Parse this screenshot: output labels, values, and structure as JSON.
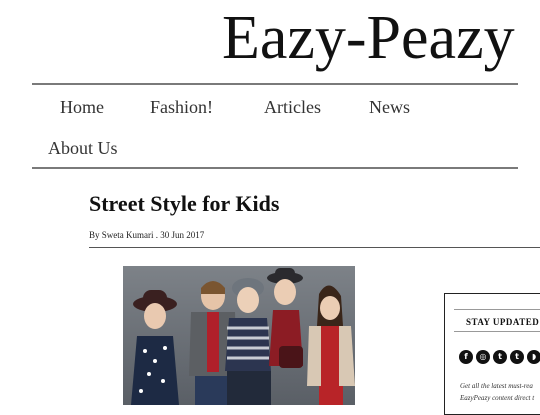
{
  "site": {
    "logo": "Eazy-Peazy"
  },
  "nav": {
    "items": [
      "Home",
      "Fashion!",
      "Articles",
      "News",
      "About Us"
    ]
  },
  "post": {
    "title": "Street Style for Kids",
    "byline": "By Sweta Kumari . 30 Jun 2017"
  },
  "sidebar": {
    "title": "STAY UPDATED",
    "social_icons": [
      "facebook-icon",
      "instagram-icon",
      "twitter-icon",
      "tumblr-icon",
      "rss-icon"
    ],
    "social_glyphs": [
      "f",
      "◎",
      "t",
      "t",
      "◗"
    ],
    "text_line1": "Get all the latest must-rea",
    "text_line2": "EazyPeazy content direct t"
  }
}
